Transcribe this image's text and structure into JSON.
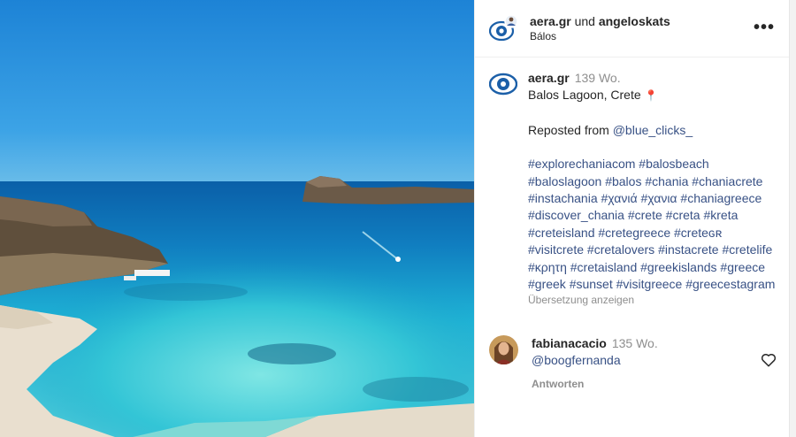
{
  "header": {
    "author": "aera.gr",
    "connector": "und",
    "coauthor": "angeloskats",
    "location": "Bálos",
    "more_icon": "ellipsis-horizontal-icon"
  },
  "caption": {
    "user": "aera.gr",
    "age": "139 Wo.",
    "line1": "Balos Lagoon, Crete",
    "pin": "📍",
    "reposted_prefix": "Reposted from",
    "reposted_handle": "@blue_clicks_",
    "hashtags": [
      "#explorechaniacom",
      "#balosbeach",
      "#baloslagoon",
      "#balos",
      "#chania",
      "#chaniacrete",
      "#instachania",
      "#χανιά",
      "#χανια",
      "#chaniagreece",
      "#discover_chania",
      "#crete",
      "#creta",
      "#kreta",
      "#creteisland",
      "#cretegreece",
      "#creteɢʀ",
      "#visitcrete",
      "#cretalovers",
      "#instacrete",
      "#cretelife",
      "#κρητη",
      "#cretaisland",
      "#greekislands",
      "#greece",
      "#greek",
      "#sunset",
      "#visitgreece",
      "#greecestagram"
    ],
    "translate": "Übersetzung anzeigen"
  },
  "comment": {
    "user": "fabianacacio",
    "age": "135 Wo.",
    "text": "@boogfernanda",
    "reply": "Antworten",
    "like_icon": "heart-outline-icon"
  },
  "colors": {
    "link": "#385185",
    "muted": "#8e8e8e",
    "text": "#262626",
    "logo_blue": "#1b5fa8"
  }
}
